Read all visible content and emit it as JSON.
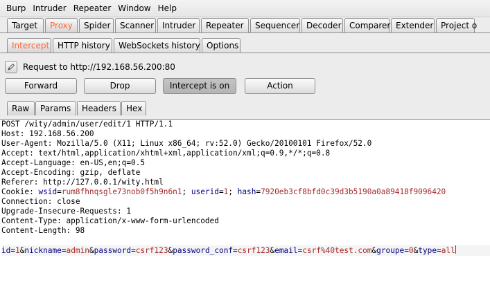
{
  "menubar": [
    "Burp",
    "Intruder",
    "Repeater",
    "Window",
    "Help"
  ],
  "main_tabs": [
    "Target",
    "Proxy",
    "Spider",
    "Scanner",
    "Intruder",
    "Repeater",
    "Sequencer",
    "Decoder",
    "Comparer",
    "Extender",
    "Project o"
  ],
  "main_tabs_active": "Proxy",
  "proxy_tabs": [
    "Intercept",
    "HTTP history",
    "WebSockets history",
    "Options"
  ],
  "proxy_tabs_active": "Intercept",
  "request_label": "Request to http://192.168.56.200:80",
  "buttons": {
    "forward": "Forward",
    "drop": "Drop",
    "intercept": "Intercept is on",
    "action": "Action"
  },
  "view_tabs": [
    "Raw",
    "Params",
    "Headers",
    "Hex"
  ],
  "view_tabs_active": "Raw",
  "colors": {
    "active_tab_text": "#ff6633",
    "param_name": "#000080",
    "param_value": "#a52a2a"
  },
  "request": {
    "lines": [
      "POST /wity/admin/user/edit/1 HTTP/1.1",
      "Host: 192.168.56.200",
      "User-Agent: Mozilla/5.0 (X11; Linux x86_64; rv:52.0) Gecko/20100101 Firefox/52.0",
      "Accept: text/html,application/xhtml+xml,application/xml;q=0.9,*/*;q=0.8",
      "Accept-Language: en-US,en;q=0.5",
      "Accept-Encoding: gzip, deflate",
      "Referer: http://127.0.0.1/wity.html"
    ],
    "cookie_prefix": "Cookie: ",
    "cookies": [
      {
        "name": "wsid",
        "value": "rum8fhnqsgle73nob0f5h9n6n1"
      },
      {
        "name": "userid",
        "value": "1"
      },
      {
        "name": "hash",
        "value": "7920eb3cf8bfd0c39d3b5190a0a89418f9096420"
      }
    ],
    "lines_after_cookie": [
      "Connection: close",
      "Upgrade-Insecure-Requests: 1",
      "Content-Type: application/x-www-form-urlencoded",
      "Content-Length: 98"
    ],
    "body_params": [
      {
        "name": "id",
        "value": "1"
      },
      {
        "name": "nickname",
        "value": "admin"
      },
      {
        "name": "password",
        "value": "csrf123"
      },
      {
        "name": "password_conf",
        "value": "csrf123"
      },
      {
        "name": "email",
        "value": "csrf%40test.com"
      },
      {
        "name": "groupe",
        "value": "0"
      },
      {
        "name": "type",
        "value": "all"
      }
    ]
  }
}
